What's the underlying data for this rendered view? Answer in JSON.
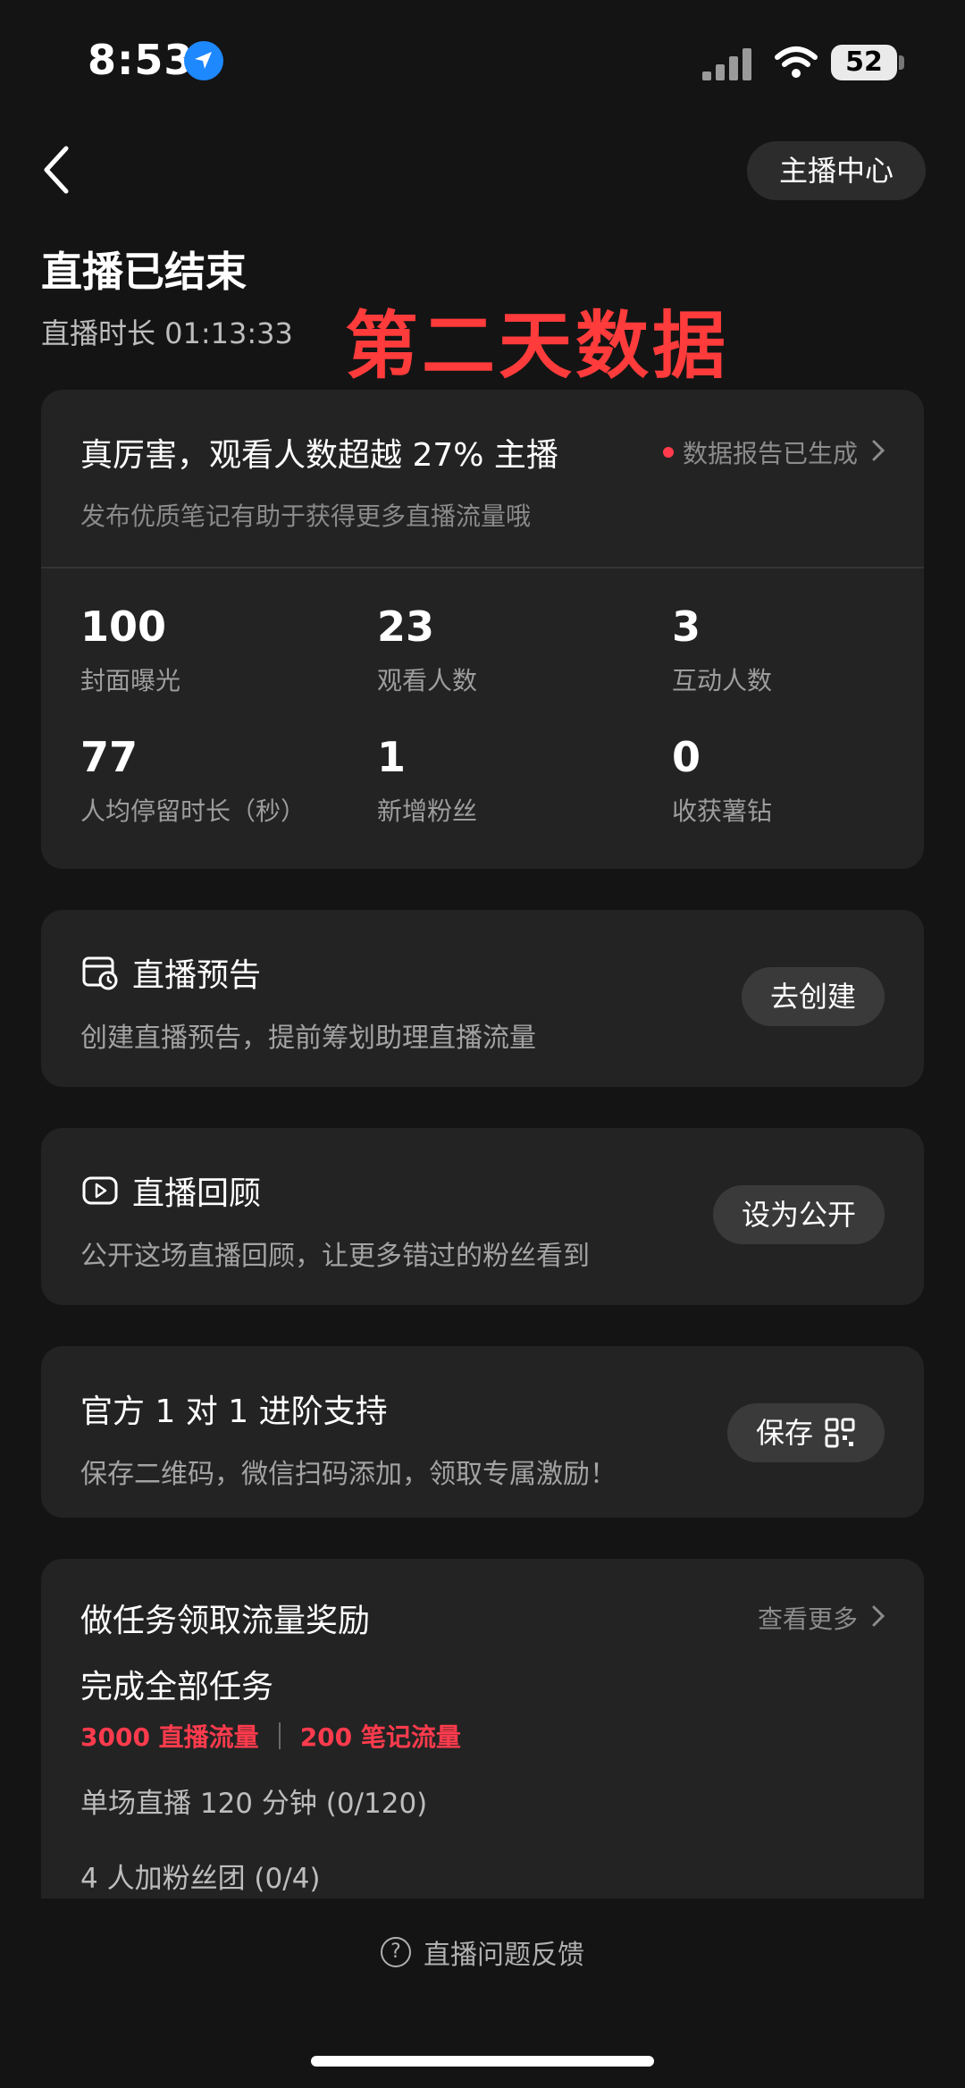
{
  "status_bar": {
    "time": "8:53",
    "battery": "52"
  },
  "header": {
    "center_button": "主播中心",
    "title": "直播已结束",
    "duration": "直播时长 01:13:33"
  },
  "overlay_text": "第二天数据",
  "summary": {
    "headline": "真厉害，观看人数超越 27% 主播",
    "report_link": "数据报告已生成",
    "subtext": "发布优质笔记有助于获得更多直播流量哦",
    "stats": [
      {
        "value": "100",
        "label": "封面曝光"
      },
      {
        "value": "23",
        "label": "观看人数"
      },
      {
        "value": "3",
        "label": "互动人数"
      },
      {
        "value": "77",
        "label": "人均停留时长（秒）"
      },
      {
        "value": "1",
        "label": "新增粉丝"
      },
      {
        "value": "0",
        "label": "收获薯钻"
      }
    ]
  },
  "cards": {
    "preview": {
      "title": "直播预告",
      "desc": "创建直播预告，提前筹划助理直播流量",
      "button": "去创建"
    },
    "replay": {
      "title": "直播回顾",
      "desc": "公开这场直播回顾，让更多错过的粉丝看到",
      "button": "设为公开"
    },
    "support": {
      "title": "官方 1 对 1 进阶支持",
      "desc": "保存二维码，微信扫码添加，领取专属激励！",
      "button": "保存"
    }
  },
  "tasks": {
    "title": "做任务领取流量奖励",
    "more": "查看更多",
    "complete_all": "完成全部任务",
    "reward1": "3000 直播流量",
    "reward2": "200 笔记流量",
    "items": [
      "单场直播 120 分钟 (0/120)",
      "4 人加粉丝团 (0/4)"
    ]
  },
  "feedback": "直播问题反馈",
  "colors": {
    "background": "#141414",
    "card": "#232323",
    "accent_red": "#ff3b4d",
    "overlay_red": "#ff3b3b"
  }
}
